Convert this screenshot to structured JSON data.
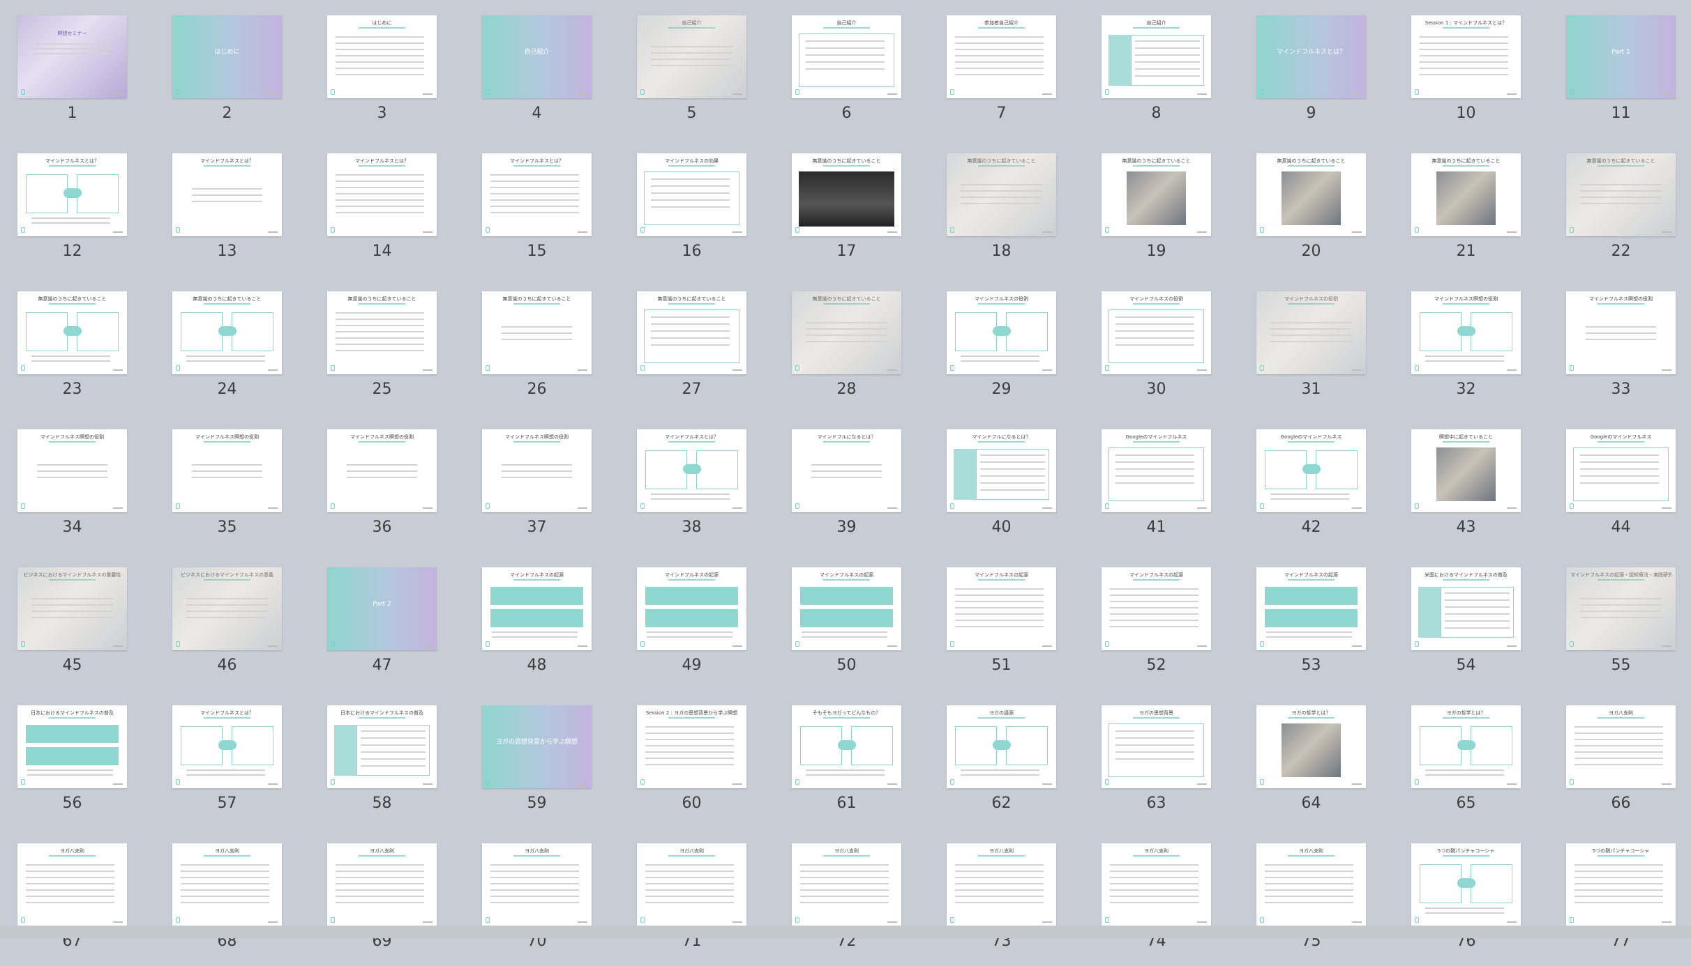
{
  "slides": [
    {
      "num": "1",
      "layout": "photo-title",
      "title": "瞑想セミナー"
    },
    {
      "num": "2",
      "layout": "section",
      "title": "はじめに"
    },
    {
      "num": "3",
      "layout": "text",
      "title": "はじめに"
    },
    {
      "num": "4",
      "layout": "section",
      "title": "自己紹介"
    },
    {
      "num": "5",
      "layout": "photo-text",
      "title": "自己紹介"
    },
    {
      "num": "6",
      "layout": "boxes",
      "title": "自己紹介"
    },
    {
      "num": "7",
      "layout": "text",
      "title": "参加者自己紹介"
    },
    {
      "num": "8",
      "layout": "table",
      "title": "自己紹介"
    },
    {
      "num": "9",
      "layout": "section",
      "title": "マインドフルネスとは？"
    },
    {
      "num": "10",
      "layout": "text",
      "title": "Session 1 : マインドフルネスとは？"
    },
    {
      "num": "11",
      "layout": "section",
      "title": "Part 1"
    },
    {
      "num": "12",
      "layout": "diagram",
      "title": "マインドフルネスとは？"
    },
    {
      "num": "13",
      "layout": "quote",
      "title": "マインドフルネスとは？"
    },
    {
      "num": "14",
      "layout": "text",
      "title": "マインドフルネスとは？"
    },
    {
      "num": "15",
      "layout": "text",
      "title": "マインドフルネスとは？"
    },
    {
      "num": "16",
      "layout": "boxes",
      "title": "マインドフルネスの効果"
    },
    {
      "num": "17",
      "layout": "dark-photo",
      "title": "無意識のうちに起きていること"
    },
    {
      "num": "18",
      "layout": "photo-text",
      "title": "無意識のうちに起きていること"
    },
    {
      "num": "19",
      "layout": "photo-center",
      "title": "無意識のうちに起きていること"
    },
    {
      "num": "20",
      "layout": "photo-center",
      "title": "無意識のうちに起きていること"
    },
    {
      "num": "21",
      "layout": "photo-center",
      "title": "無意識のうちに起きていること"
    },
    {
      "num": "22",
      "layout": "photo-text",
      "title": "無意識のうちに起きていること"
    },
    {
      "num": "23",
      "layout": "diagram",
      "title": "無意識のうちに起きていること"
    },
    {
      "num": "24",
      "layout": "diagram",
      "title": "無意識のうちに起きていること"
    },
    {
      "num": "25",
      "layout": "text",
      "title": "無意識のうちに起きていること"
    },
    {
      "num": "26",
      "layout": "quote",
      "title": "無意識のうちに起きていること"
    },
    {
      "num": "27",
      "layout": "boxes",
      "title": "無意識のうちに起きていること"
    },
    {
      "num": "28",
      "layout": "photo-text",
      "title": "無意識のうちに起きていること"
    },
    {
      "num": "29",
      "layout": "diagram",
      "title": "マインドフルネスの役割"
    },
    {
      "num": "30",
      "layout": "boxes",
      "title": "マインドフルネスの役割"
    },
    {
      "num": "31",
      "layout": "photo-text",
      "title": "マインドフルネスの役割"
    },
    {
      "num": "32",
      "layout": "diagram",
      "title": "マインドフルネス瞑想の役割"
    },
    {
      "num": "33",
      "layout": "quote",
      "title": "マインドフルネス瞑想の役割"
    },
    {
      "num": "34",
      "layout": "quote",
      "title": "マインドフルネス瞑想の役割"
    },
    {
      "num": "35",
      "layout": "quote",
      "title": "マインドフルネス瞑想の役割"
    },
    {
      "num": "36",
      "layout": "quote",
      "title": "マインドフルネス瞑想の役割"
    },
    {
      "num": "37",
      "layout": "quote",
      "title": "マインドフルネス瞑想の役割"
    },
    {
      "num": "38",
      "layout": "diagram",
      "title": "マインドフルネスとは？"
    },
    {
      "num": "39",
      "layout": "quote",
      "title": "マインドフルになるとは？"
    },
    {
      "num": "40",
      "layout": "table",
      "title": "マインドフルになるとは？"
    },
    {
      "num": "41",
      "layout": "boxes",
      "title": "Googleのマインドフルネス"
    },
    {
      "num": "42",
      "layout": "diagram",
      "title": "Googleのマインドフルネス"
    },
    {
      "num": "43",
      "layout": "photo-center",
      "title": "瞑想中に起きていること"
    },
    {
      "num": "44",
      "layout": "boxes",
      "title": "Googleのマインドフルネス"
    },
    {
      "num": "45",
      "layout": "photo-text",
      "title": "ビジネスにおけるマインドフルネスの重要性"
    },
    {
      "num": "46",
      "layout": "photo-text",
      "title": "ビジネスにおけるマインドフルネスの意義"
    },
    {
      "num": "47",
      "layout": "section",
      "title": "Part 2"
    },
    {
      "num": "48",
      "layout": "tealboxes",
      "title": "マインドフルネスの起源"
    },
    {
      "num": "49",
      "layout": "tealboxes",
      "title": "マインドフルネスの起源"
    },
    {
      "num": "50",
      "layout": "tealboxes",
      "title": "マインドフルネスの起源"
    },
    {
      "num": "51",
      "layout": "text",
      "title": "マインドフルネスの起源"
    },
    {
      "num": "52",
      "layout": "text",
      "title": "マインドフルネスの起源"
    },
    {
      "num": "53",
      "layout": "tealboxes",
      "title": "マインドフルネスの起源"
    },
    {
      "num": "54",
      "layout": "table",
      "title": "米国におけるマインドフルネスの普及"
    },
    {
      "num": "55",
      "layout": "photo-text",
      "title": "マインドフルネスの起源・認知療法・実践研究"
    },
    {
      "num": "56",
      "layout": "tealboxes",
      "title": "日本におけるマインドフルネスの普及"
    },
    {
      "num": "57",
      "layout": "diagram",
      "title": "マインドフルネスとは？"
    },
    {
      "num": "58",
      "layout": "table",
      "title": "日本におけるマインドフルネスの普及"
    },
    {
      "num": "59",
      "layout": "section",
      "title": "ヨガの思想背景から学ぶ瞑想"
    },
    {
      "num": "60",
      "layout": "text",
      "title": "Session 2 : ヨガの思想背景から学ぶ瞑想"
    },
    {
      "num": "61",
      "layout": "diagram",
      "title": "そもそもヨガってどんなもの？"
    },
    {
      "num": "62",
      "layout": "diagram",
      "title": "ヨガの語源"
    },
    {
      "num": "63",
      "layout": "boxes",
      "title": "ヨガの思想背景"
    },
    {
      "num": "64",
      "layout": "photo-center",
      "title": "ヨガの哲学とは？"
    },
    {
      "num": "65",
      "layout": "diagram",
      "title": "ヨガの哲学とは？"
    },
    {
      "num": "66",
      "layout": "text",
      "title": "ヨガ八支則"
    },
    {
      "num": "67",
      "layout": "text",
      "title": "ヨガ八支則"
    },
    {
      "num": "68",
      "layout": "text",
      "title": "ヨガ八支則"
    },
    {
      "num": "69",
      "layout": "text",
      "title": "ヨガ八支則"
    },
    {
      "num": "70",
      "layout": "text",
      "title": "ヨガ八支則"
    },
    {
      "num": "71",
      "layout": "text",
      "title": "ヨガ八支則"
    },
    {
      "num": "72",
      "layout": "text",
      "title": "ヨガ八支則"
    },
    {
      "num": "73",
      "layout": "text",
      "title": "ヨガ八支則"
    },
    {
      "num": "74",
      "layout": "text",
      "title": "ヨガ八支則"
    },
    {
      "num": "75",
      "layout": "text",
      "title": "ヨガ八支則"
    },
    {
      "num": "76",
      "layout": "diagram",
      "title": "5つの鞘パンチャコーシャ"
    },
    {
      "num": "77",
      "layout": "text",
      "title": "5つの鞘パンチャコーシャ"
    }
  ],
  "colors": {
    "background": "#c7ccd5",
    "accent": "#3eb8b2",
    "section_gradient": [
      "#8fd6cf",
      "#c4b3df"
    ]
  }
}
